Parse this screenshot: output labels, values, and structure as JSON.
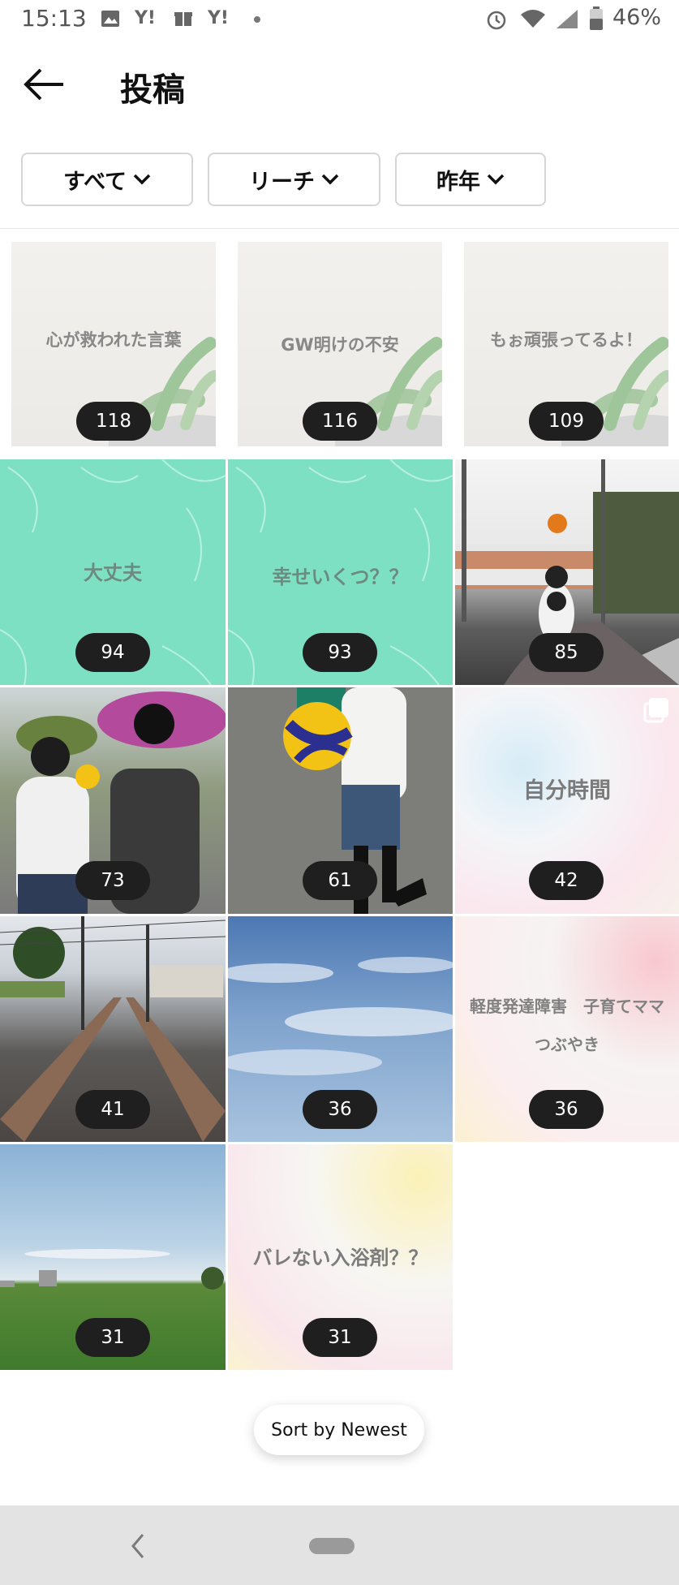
{
  "status_bar": {
    "time": "15:13",
    "left_icons": [
      "image-icon",
      "yahoo-icon",
      "gift-icon",
      "yahoo-icon",
      "dot-icon"
    ],
    "right_icons": [
      "alarm-icon",
      "wifi-icon",
      "signal-icon",
      "battery-icon"
    ],
    "battery": "46%"
  },
  "header": {
    "title": "投稿",
    "back_icon": "arrow-left-icon"
  },
  "filters": [
    {
      "label": "すべて",
      "icon": "chevron-down-icon"
    },
    {
      "label": "リーチ",
      "icon": "chevron-down-icon"
    },
    {
      "label": "昨年",
      "icon": "chevron-down-icon"
    }
  ],
  "posts": [
    {
      "text": "心が救われた言葉",
      "reach": "118",
      "style": "succulent"
    },
    {
      "text": "GW明けの不安",
      "reach": "116",
      "style": "succulent"
    },
    {
      "text": "もぉ頑張ってるよ！",
      "reach": "109",
      "style": "succulent"
    },
    {
      "text": "大丈夫",
      "reach": "94",
      "style": "mint"
    },
    {
      "text": "幸せいくつ？？",
      "reach": "93",
      "style": "mint"
    },
    {
      "text": "",
      "reach": "85",
      "style": "photo-volleyball-street"
    },
    {
      "text": "",
      "reach": "73",
      "style": "photo-kids"
    },
    {
      "text": "",
      "reach": "61",
      "style": "photo-ball-holder"
    },
    {
      "text": "自分時間",
      "reach": "42",
      "style": "pastel",
      "multi": true
    },
    {
      "text": "",
      "reach": "41",
      "style": "photo-railway"
    },
    {
      "text": "",
      "reach": "36",
      "style": "photo-sky"
    },
    {
      "text": "軽度発達障害　子育てママ",
      "text2": "つぶやき",
      "reach": "36",
      "style": "pastel"
    },
    {
      "text": "",
      "reach": "31",
      "style": "photo-field"
    },
    {
      "text": "バレない入浴剤？？",
      "reach": "31",
      "style": "pastel-yellow"
    }
  ],
  "sort_button": {
    "label": "Sort by Newest"
  },
  "colors": {
    "mint": "#7ee0c3",
    "badge": "#1f1f1f",
    "navbar": "#e3e3e3"
  }
}
